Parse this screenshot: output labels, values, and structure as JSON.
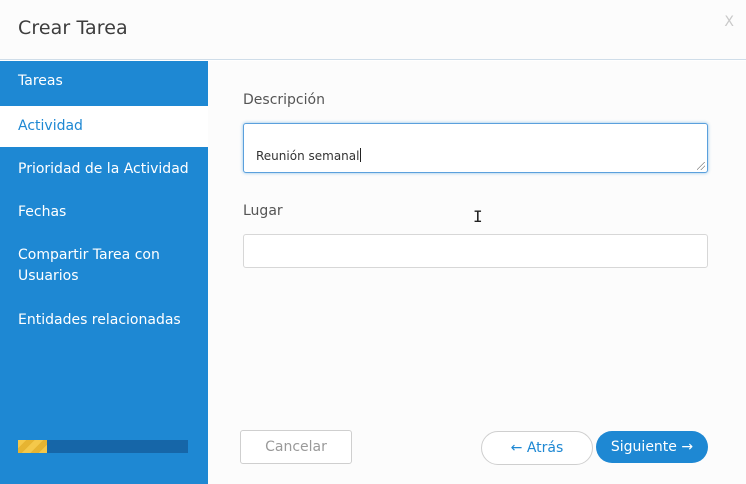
{
  "dialog": {
    "title": "Crear Tarea",
    "close_label": "X"
  },
  "sidebar": {
    "items": [
      {
        "label": "Tareas",
        "active": false
      },
      {
        "label": "Actividad",
        "active": true
      },
      {
        "label": "Prioridad de la Actividad",
        "active": false
      },
      {
        "label": "Fechas",
        "active": false
      },
      {
        "label": "Compartir Tarea con Usuarios",
        "active": false
      },
      {
        "label": "Entidades relacionadas",
        "active": false
      }
    ],
    "progress": 0.17
  },
  "form": {
    "descripcion_label": "Descripción",
    "descripcion_value": "Reunión semanal",
    "lugar_label": "Lugar",
    "lugar_value": ""
  },
  "footer": {
    "cancel_label": "Cancelar",
    "back_label": "← Atrás",
    "next_label": "Siguiente →"
  },
  "colors": {
    "accent": "#1e88d3",
    "progress": "#f4c84a"
  }
}
